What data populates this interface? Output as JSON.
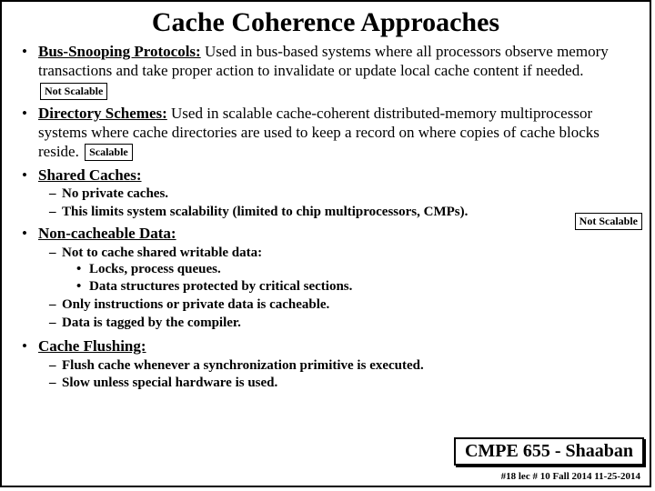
{
  "title": "Cache Coherence Approaches",
  "bullets": {
    "bus": {
      "heading": "Bus-Snooping Protocols:",
      "text": " Used in bus-based systems where all processors observe memory transactions and take proper action to invalidate or update local cache content if needed.",
      "tag": "Not Scalable"
    },
    "dir": {
      "heading": "Directory Schemes:",
      "text": " Used in scalable cache-coherent distributed-memory multiprocessor systems where cache directories are used to keep a record on where copies of cache blocks reside.",
      "tag": "Scalable"
    },
    "shared": {
      "heading": "Shared Caches:",
      "sub1": "No private caches.",
      "sub2": "This limits system scalability (limited to chip multiprocessors, CMPs)."
    },
    "noncache": {
      "heading": "Non-cacheable Data:",
      "tag": "Not Scalable",
      "sub1": "Not to cache shared writable data:",
      "sub1a": "Locks, process queues.",
      "sub1b": "Data structures protected by critical sections.",
      "sub2": "Only instructions or private data is cacheable.",
      "sub3": "Data is tagged by the compiler."
    },
    "flush": {
      "heading": "Cache Flushing:",
      "sub1": "Flush cache whenever a synchronization primitive is executed.",
      "sub2": "Slow unless special hardware is used."
    }
  },
  "course": "CMPE 655 - Shaaban",
  "footer": "#18   lec # 10   Fall 2014    11-25-2014"
}
